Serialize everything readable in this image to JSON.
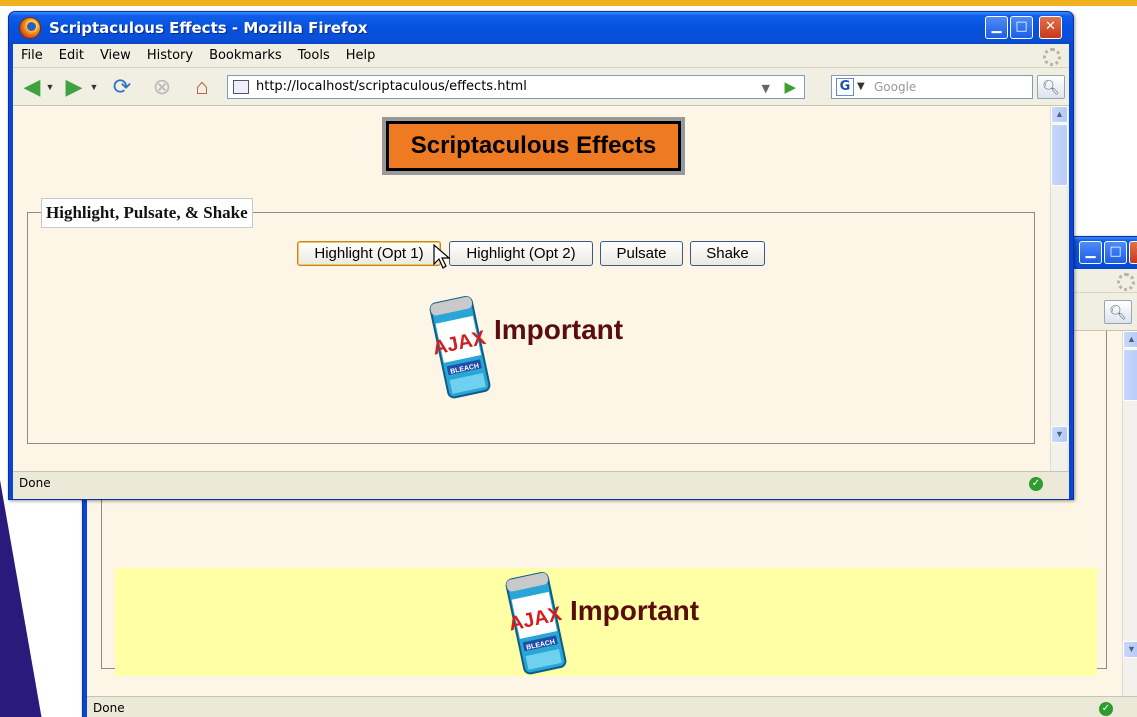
{
  "window_title": "Scriptaculous Effects - Mozilla Firefox",
  "menu": [
    "File",
    "Edit",
    "View",
    "History",
    "Bookmarks",
    "Tools",
    "Help"
  ],
  "url": "http://localhost/scriptaculous/effects.html",
  "search_placeholder": "Google",
  "search_engine_letter": "G",
  "page_heading": "Scriptaculous Effects",
  "fieldset_legend": "Highlight, Pulsate, & Shake",
  "buttons": {
    "highlight1": "Highlight (Opt 1)",
    "highlight2": "Highlight (Opt 2)",
    "pulsate": "Pulsate",
    "shake": "Shake"
  },
  "important_text": "Important",
  "can_brand": "AJAX",
  "can_sub": "BLEACH",
  "status": "Done",
  "colors": {
    "heading_bg": "#ee7b22",
    "highlight_bg": "#ffffa6",
    "important_text": "#5a0d0d",
    "xp_titlebar": "#0652e0",
    "page_bg": "#fdf5e6"
  },
  "icons": {
    "back": "back-arrow-icon",
    "forward": "forward-arrow-icon",
    "reload": "reload-icon",
    "stop": "stop-icon",
    "home": "home-icon",
    "go": "go-icon",
    "search": "magnifier-icon",
    "status": "checkmark-icon"
  }
}
